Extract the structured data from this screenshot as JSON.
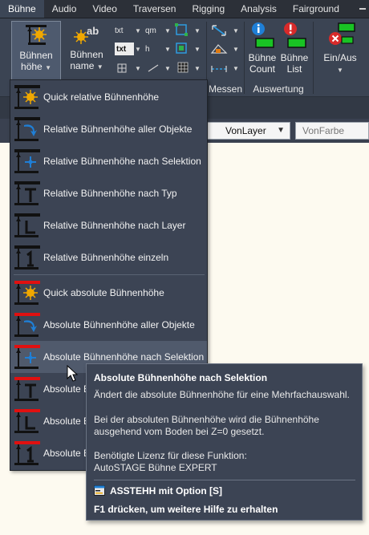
{
  "tabs": [
    "Bühne",
    "Audio",
    "Video",
    "Traversen",
    "Rigging",
    "Analysis",
    "Fairground"
  ],
  "ribbon": {
    "buehnen_hoehe": {
      "line1": "Bühnen",
      "line2": "höhe"
    },
    "buehnen_name": {
      "line1": "Bühnen",
      "line2": "name"
    },
    "txt1": "txt",
    "txt2": "txt",
    "qm": "qm",
    "h": "h",
    "h_mark": "h",
    "ab": "ab",
    "buehne_count": {
      "line1": "Bühne",
      "line2": "Count"
    },
    "buehne_list": {
      "line1": "Bühne",
      "line2": "List"
    },
    "ein_aus": "Ein/Aus",
    "panel_messen": "Messen",
    "panel_auswertung": "Auswertung"
  },
  "propbar": {
    "layer": "VonLayer",
    "color": "VonFarbe"
  },
  "menu": {
    "items": [
      "Quick relative Bühnenhöhe",
      "Relative Bühnenhöhe aller Objekte",
      "Relative Bühnenhöhe nach Selektion",
      "Relative Bühnenhöhe nach Typ",
      "Relative Bühnenhöhe nach Layer",
      "Relative Bühnenhöhe einzeln",
      "Quick absolute Bühnenhöhe",
      "Absolute Bühnenhöhe aller Objekte",
      "Absolute Bühnenhöhe nach Selektion",
      "Absolute B",
      "Absolute B",
      "Absolute B"
    ],
    "hovered_index": 8
  },
  "tooltip": {
    "title": "Absolute Bühnenhöhe nach Selektion",
    "desc": "Ändert die absolute Bühnenhöhe für eine Mehrfachauswahl.",
    "detail_1": "Bei der absoluten Bühnenhöhe wird die Bühnenhöhe",
    "detail_2": "ausgehend vom Boden bei Z=0 gesetzt.",
    "license_label": "Benötigte Lizenz für diese Funktion:",
    "license_value": "AutoSTAGE Bühne EXPERT",
    "command": "ASSTEHH mit Option [S]",
    "help": "F1 drücken, um weitere Hilfe zu erhalten"
  },
  "colors": {
    "relative_bar": "#111111",
    "absolute_bar": "#e01010",
    "accent_blue": "#1f7fd6",
    "accent_red": "#d82a2a",
    "accent_green": "#19c324"
  }
}
